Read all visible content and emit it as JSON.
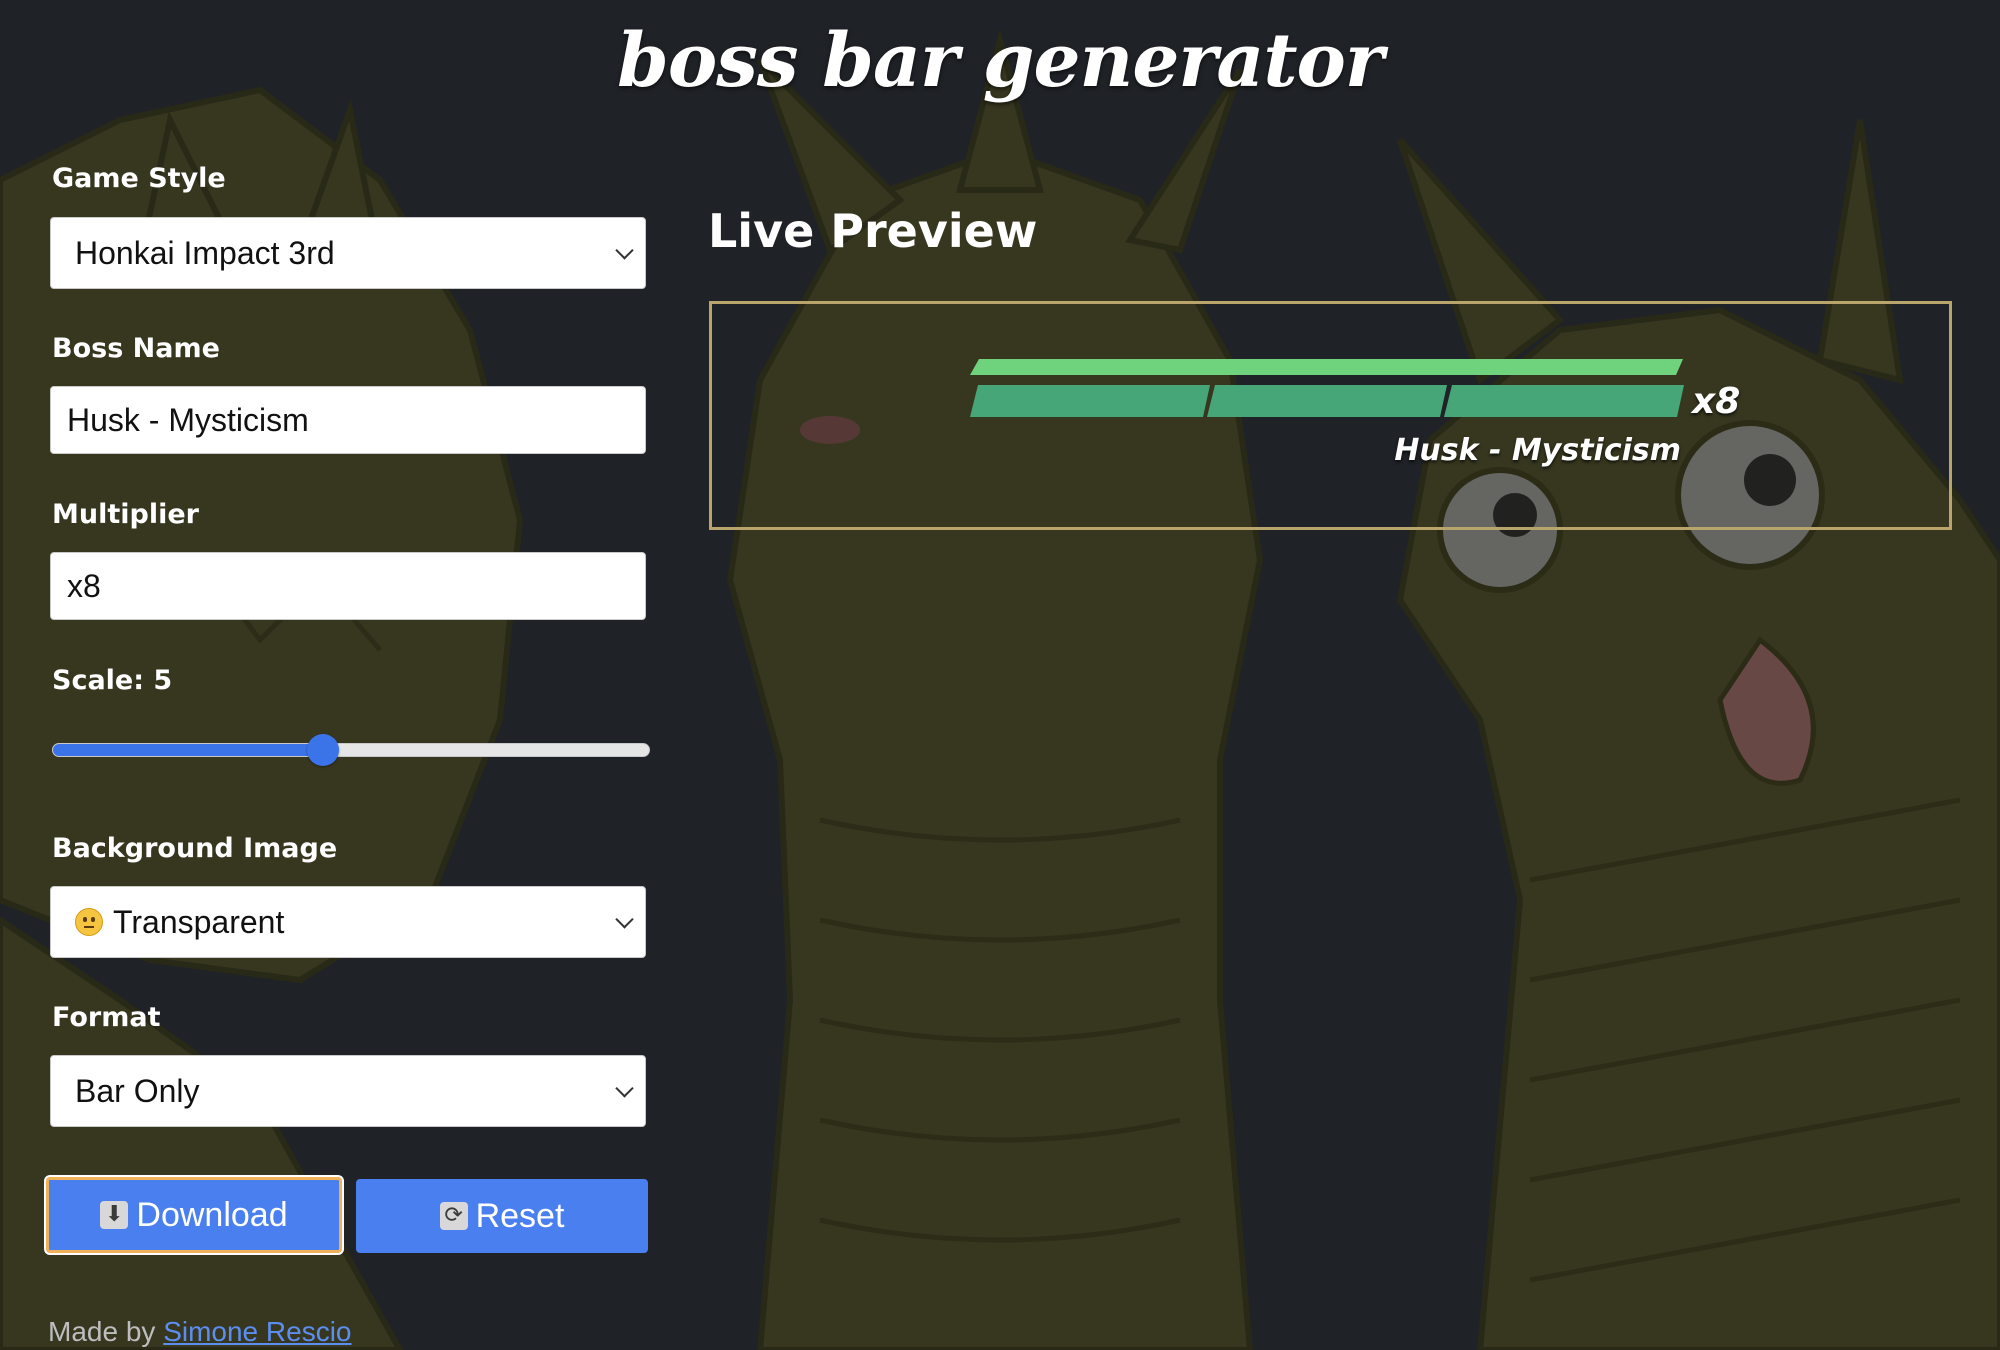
{
  "app": {
    "title": "boss bar generator"
  },
  "form": {
    "game_style": {
      "label": "Game Style",
      "selected": "Honkai Impact 3rd"
    },
    "boss_name": {
      "label": "Boss Name",
      "value": "Husk - Mysticism"
    },
    "multiplier": {
      "label": "Multiplier",
      "value": "x8"
    },
    "scale": {
      "label": "Scale: 5",
      "level_fraction": 0.45
    },
    "background_image": {
      "label": "Background Image",
      "selected": "Transparent",
      "icon": "neutral-face-icon"
    },
    "format": {
      "label": "Format",
      "selected": "Bar Only"
    },
    "buttons": {
      "download_label": "Download",
      "download_icon": "down-arrow-icon",
      "reset_label": "Reset",
      "reset_icon": "refresh-icon"
    }
  },
  "footer": {
    "prefix": "Made by",
    "author": "Simone Rescio"
  },
  "preview": {
    "heading": "Live Preview",
    "boss_name": "Husk - Mysticism",
    "multiplier": "x8",
    "bar_segments": 3,
    "colors": {
      "bar_top": "#6fd37d",
      "bar_segment": "#46a677",
      "frame": "#b9a46c"
    }
  },
  "theme": {
    "background": "#1f2227",
    "accent": "#4a7ff0",
    "focus_ring": "#f0b15a"
  }
}
